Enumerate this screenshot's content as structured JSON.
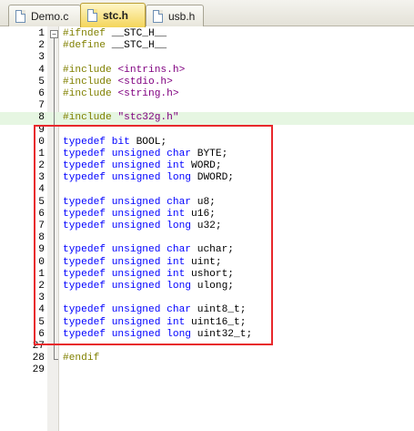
{
  "tabs": [
    {
      "label": "Demo.c",
      "active": false
    },
    {
      "label": "stc.h",
      "active": true
    },
    {
      "label": "usb.h",
      "active": false
    }
  ],
  "colors": {
    "keyword": "#0000ff",
    "preprocessor": "#808000",
    "include_path": "#800080",
    "annotation_box": "#e8282c",
    "active_tab": "#f4d55a",
    "current_line": "#e6f6e2"
  },
  "highlighted_line": 8,
  "annotation": {
    "from_line": 10,
    "to_line": 27
  },
  "lines": [
    {
      "num": "1",
      "tokens": [
        {
          "c": "pp",
          "t": "#ifndef"
        },
        {
          "c": "pl",
          "t": " __STC_H__"
        }
      ]
    },
    {
      "num": "2",
      "tokens": [
        {
          "c": "pp",
          "t": "#define"
        },
        {
          "c": "pl",
          "t": " __STC_H__"
        }
      ]
    },
    {
      "num": "3",
      "tokens": []
    },
    {
      "num": "4",
      "tokens": [
        {
          "c": "pp",
          "t": "#include"
        },
        {
          "c": "pl",
          "t": " "
        },
        {
          "c": "str",
          "t": "<intrins.h>"
        }
      ]
    },
    {
      "num": "5",
      "tokens": [
        {
          "c": "pp",
          "t": "#include"
        },
        {
          "c": "pl",
          "t": " "
        },
        {
          "c": "str",
          "t": "<stdio.h>"
        }
      ]
    },
    {
      "num": "6",
      "tokens": [
        {
          "c": "pp",
          "t": "#include"
        },
        {
          "c": "pl",
          "t": " "
        },
        {
          "c": "str",
          "t": "<string.h>"
        }
      ]
    },
    {
      "num": "7",
      "tokens": []
    },
    {
      "num": "8",
      "tokens": [
        {
          "c": "pp",
          "t": "#include"
        },
        {
          "c": "pl",
          "t": " "
        },
        {
          "c": "str",
          "t": "\"stc32g.h\""
        }
      ]
    },
    {
      "num": "9",
      "tokens": []
    },
    {
      "num": "0",
      "tokens": [
        {
          "c": "kw",
          "t": "typedef"
        },
        {
          "c": "pl",
          "t": " "
        },
        {
          "c": "kw",
          "t": "bit"
        },
        {
          "c": "pl",
          "t": " BOOL;"
        }
      ]
    },
    {
      "num": "1",
      "tokens": [
        {
          "c": "kw",
          "t": "typedef"
        },
        {
          "c": "pl",
          "t": " "
        },
        {
          "c": "kw",
          "t": "unsigned"
        },
        {
          "c": "pl",
          "t": " "
        },
        {
          "c": "kw",
          "t": "char"
        },
        {
          "c": "pl",
          "t": " BYTE;"
        }
      ]
    },
    {
      "num": "2",
      "tokens": [
        {
          "c": "kw",
          "t": "typedef"
        },
        {
          "c": "pl",
          "t": " "
        },
        {
          "c": "kw",
          "t": "unsigned"
        },
        {
          "c": "pl",
          "t": " "
        },
        {
          "c": "kw",
          "t": "int"
        },
        {
          "c": "pl",
          "t": " WORD;"
        }
      ]
    },
    {
      "num": "3",
      "tokens": [
        {
          "c": "kw",
          "t": "typedef"
        },
        {
          "c": "pl",
          "t": " "
        },
        {
          "c": "kw",
          "t": "unsigned"
        },
        {
          "c": "pl",
          "t": " "
        },
        {
          "c": "kw",
          "t": "long"
        },
        {
          "c": "pl",
          "t": " DWORD;"
        }
      ]
    },
    {
      "num": "4",
      "tokens": []
    },
    {
      "num": "5",
      "tokens": [
        {
          "c": "kw",
          "t": "typedef"
        },
        {
          "c": "pl",
          "t": " "
        },
        {
          "c": "kw",
          "t": "unsigned"
        },
        {
          "c": "pl",
          "t": " "
        },
        {
          "c": "kw",
          "t": "char"
        },
        {
          "c": "pl",
          "t": " u8;"
        }
      ]
    },
    {
      "num": "6",
      "tokens": [
        {
          "c": "kw",
          "t": "typedef"
        },
        {
          "c": "pl",
          "t": " "
        },
        {
          "c": "kw",
          "t": "unsigned"
        },
        {
          "c": "pl",
          "t": " "
        },
        {
          "c": "kw",
          "t": "int"
        },
        {
          "c": "pl",
          "t": " u16;"
        }
      ]
    },
    {
      "num": "7",
      "tokens": [
        {
          "c": "kw",
          "t": "typedef"
        },
        {
          "c": "pl",
          "t": " "
        },
        {
          "c": "kw",
          "t": "unsigned"
        },
        {
          "c": "pl",
          "t": " "
        },
        {
          "c": "kw",
          "t": "long"
        },
        {
          "c": "pl",
          "t": " u32;"
        }
      ]
    },
    {
      "num": "8",
      "tokens": []
    },
    {
      "num": "9",
      "tokens": [
        {
          "c": "kw",
          "t": "typedef"
        },
        {
          "c": "pl",
          "t": " "
        },
        {
          "c": "kw",
          "t": "unsigned"
        },
        {
          "c": "pl",
          "t": " "
        },
        {
          "c": "kw",
          "t": "char"
        },
        {
          "c": "pl",
          "t": " uchar;"
        }
      ]
    },
    {
      "num": "0",
      "tokens": [
        {
          "c": "kw",
          "t": "typedef"
        },
        {
          "c": "pl",
          "t": " "
        },
        {
          "c": "kw",
          "t": "unsigned"
        },
        {
          "c": "pl",
          "t": " "
        },
        {
          "c": "kw",
          "t": "int"
        },
        {
          "c": "pl",
          "t": " uint;"
        }
      ]
    },
    {
      "num": "1",
      "tokens": [
        {
          "c": "kw",
          "t": "typedef"
        },
        {
          "c": "pl",
          "t": " "
        },
        {
          "c": "kw",
          "t": "unsigned"
        },
        {
          "c": "pl",
          "t": " "
        },
        {
          "c": "kw",
          "t": "int"
        },
        {
          "c": "pl",
          "t": " ushort;"
        }
      ]
    },
    {
      "num": "2",
      "tokens": [
        {
          "c": "kw",
          "t": "typedef"
        },
        {
          "c": "pl",
          "t": " "
        },
        {
          "c": "kw",
          "t": "unsigned"
        },
        {
          "c": "pl",
          "t": " "
        },
        {
          "c": "kw",
          "t": "long"
        },
        {
          "c": "pl",
          "t": " ulong;"
        }
      ]
    },
    {
      "num": "3",
      "tokens": []
    },
    {
      "num": "4",
      "tokens": [
        {
          "c": "kw",
          "t": "typedef"
        },
        {
          "c": "pl",
          "t": " "
        },
        {
          "c": "kw",
          "t": "unsigned"
        },
        {
          "c": "pl",
          "t": " "
        },
        {
          "c": "kw",
          "t": "char"
        },
        {
          "c": "pl",
          "t": " uint8_t;"
        }
      ]
    },
    {
      "num": "5",
      "tokens": [
        {
          "c": "kw",
          "t": "typedef"
        },
        {
          "c": "pl",
          "t": " "
        },
        {
          "c": "kw",
          "t": "unsigned"
        },
        {
          "c": "pl",
          "t": " "
        },
        {
          "c": "kw",
          "t": "int"
        },
        {
          "c": "pl",
          "t": " uint16_t;"
        }
      ]
    },
    {
      "num": "6",
      "tokens": [
        {
          "c": "kw",
          "t": "typedef"
        },
        {
          "c": "pl",
          "t": " "
        },
        {
          "c": "kw",
          "t": "unsigned"
        },
        {
          "c": "pl",
          "t": " "
        },
        {
          "c": "kw",
          "t": "long"
        },
        {
          "c": "pl",
          "t": " uint32_t;"
        }
      ]
    },
    {
      "num": "27",
      "tokens": []
    },
    {
      "num": "28",
      "tokens": [
        {
          "c": "pp",
          "t": "#endif"
        }
      ]
    },
    {
      "num": "29",
      "tokens": []
    }
  ]
}
